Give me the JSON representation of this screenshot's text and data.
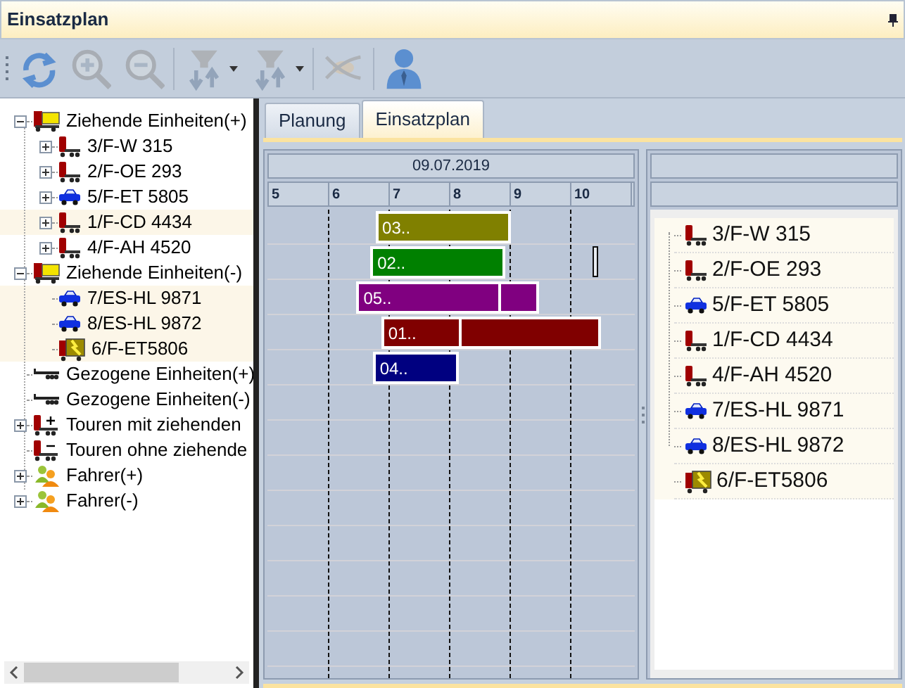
{
  "window": {
    "title": "Einsatzplan"
  },
  "toolbar": [
    {
      "kind": "refresh",
      "disabled": false
    },
    {
      "kind": "zoom-in",
      "disabled": true
    },
    {
      "kind": "zoom-out",
      "disabled": true
    },
    {
      "kind": "filter-sort",
      "disabled": true
    },
    {
      "kind": "filter-sort",
      "disabled": true
    },
    {
      "kind": "orbit",
      "disabled": true
    },
    {
      "kind": "user",
      "disabled": false
    }
  ],
  "tree": [
    {
      "label": "Ziehende Einheiten(+)",
      "kind": "yellow-truck",
      "has_children": true,
      "expanded": true,
      "highlighted": false,
      "children": [
        {
          "label": "3/F-W 315",
          "kind": "tractor",
          "has_children": true,
          "expanded": false,
          "highlighted": false
        },
        {
          "label": "2/F-OE 293",
          "kind": "tractor",
          "has_children": true,
          "expanded": false,
          "highlighted": false
        },
        {
          "label": "5/F-ET 5805",
          "kind": "car",
          "has_children": true,
          "expanded": false,
          "highlighted": false
        },
        {
          "label": "1/F-CD 4434",
          "kind": "tractor",
          "has_children": true,
          "expanded": false,
          "highlighted": true
        },
        {
          "label": "4/F-AH 4520",
          "kind": "tractor",
          "has_children": true,
          "expanded": false,
          "highlighted": false
        }
      ]
    },
    {
      "label": "Ziehende Einheiten(-)",
      "kind": "yellow-truck",
      "has_children": true,
      "expanded": true,
      "highlighted": false,
      "children": [
        {
          "label": "7/ES-HL 9871",
          "kind": "car",
          "has_children": false,
          "expanded": false,
          "highlighted": true
        },
        {
          "label": "8/ES-HL 9872",
          "kind": "car",
          "has_children": false,
          "expanded": false,
          "highlighted": true
        },
        {
          "label": "6/F-ET5806",
          "kind": "box-truck",
          "has_children": false,
          "expanded": false,
          "highlighted": true
        }
      ]
    },
    {
      "label": "Gezogene Einheiten(+)",
      "kind": "trailer",
      "has_children": false,
      "expanded": false,
      "highlighted": false
    },
    {
      "label": "Gezogene Einheiten(-)",
      "kind": "trailer",
      "has_children": false,
      "expanded": false,
      "highlighted": false
    },
    {
      "label": "Touren mit ziehenden",
      "kind": "tour-plus",
      "has_children": true,
      "expanded": false,
      "highlighted": false
    },
    {
      "label": "Touren ohne ziehende",
      "kind": "tour-minus",
      "has_children": false,
      "expanded": false,
      "highlighted": false
    },
    {
      "label": "Fahrer(+)",
      "kind": "people",
      "has_children": true,
      "expanded": false,
      "highlighted": false
    },
    {
      "label": "Fahrer(-)",
      "kind": "people",
      "has_children": true,
      "expanded": false,
      "highlighted": false
    }
  ],
  "tabs": [
    {
      "label": "Planung",
      "selected": false
    },
    {
      "label": "Einsatzplan",
      "selected": true
    }
  ],
  "gantt": {
    "date": "09.07.2019",
    "hours": [
      "5",
      "6",
      "7",
      "8",
      "9",
      "10"
    ],
    "bars": [
      {
        "label": "03..",
        "color": "#808000"
      },
      {
        "label": "02..",
        "color": "#008000"
      },
      {
        "label": "05..",
        "color": "#800080"
      },
      {
        "label": "01..",
        "color": "#800000"
      },
      {
        "label": "04..",
        "color": "#000080"
      }
    ]
  },
  "vehicles": [
    {
      "label": "3/F-W 315",
      "kind": "tractor"
    },
    {
      "label": "2/F-OE 293",
      "kind": "tractor"
    },
    {
      "label": "5/F-ET 5805",
      "kind": "car"
    },
    {
      "label": "1/F-CD 4434",
      "kind": "tractor"
    },
    {
      "label": "4/F-AH 4520",
      "kind": "tractor"
    },
    {
      "label": "7/ES-HL 9871",
      "kind": "car"
    },
    {
      "label": "8/ES-HL 9872",
      "kind": "car"
    },
    {
      "label": "6/F-ET5806",
      "kind": "box-truck"
    }
  ]
}
